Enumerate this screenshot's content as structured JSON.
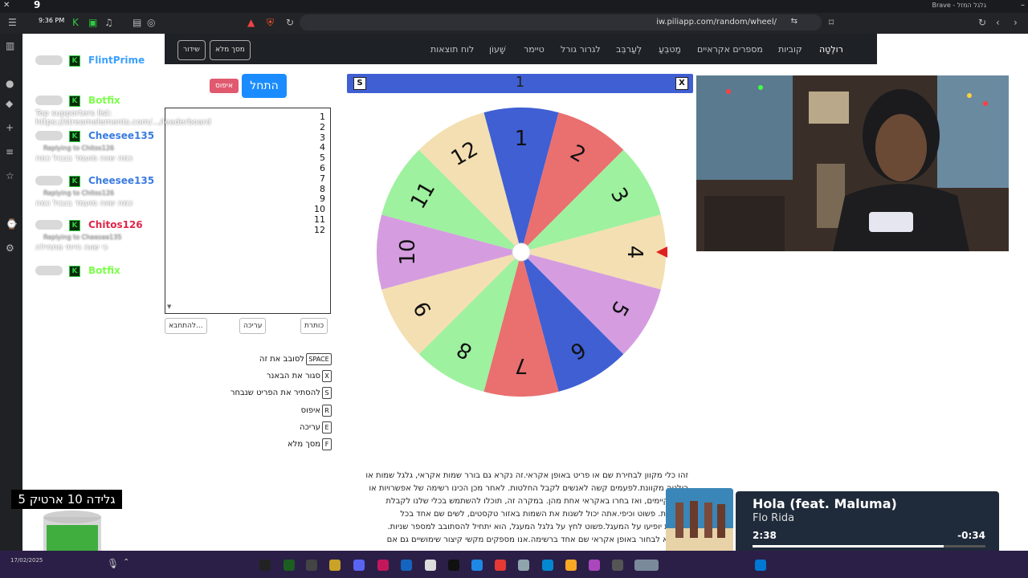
{
  "system": {
    "counter": "9",
    "browser_label": "Brave - גלגל המזל",
    "clock": "9:36 PM"
  },
  "browser": {
    "url": "iw.piliapp.com/random/wheel/"
  },
  "nav": {
    "items": [
      "רולֶטָה",
      "קוביות",
      "מספרים אקראיים",
      "מַטבֵּעַ",
      "לגרור גורל",
      "לְעַרבֵּב",
      "טיימר",
      "שָׁעוֹן",
      "לוח תוצאות"
    ],
    "fullscreen": "מסך מלא",
    "share": "שידור"
  },
  "controls": {
    "start": "התחל",
    "reset": "איפוס",
    "list": [
      "1",
      "2",
      "3",
      "4",
      "5",
      "6",
      "7",
      "8",
      "9",
      "10",
      "11",
      "12"
    ],
    "btn_title": "כותרת",
    "btn_edit": "עריכה",
    "btn_begin": "להתחבא..."
  },
  "shortcuts": [
    {
      "key": "SPACE",
      "label": "לסובב את זה"
    },
    {
      "key": "X",
      "label": "סגור את הבאנר"
    },
    {
      "key": "S",
      "label": "להסתיר את הפריט שנבחר"
    },
    {
      "key": "R",
      "label": "איפוס"
    },
    {
      "key": "E",
      "label": "עריכה"
    },
    {
      "key": "F",
      "label": "מסך מלא"
    }
  ],
  "wheel": {
    "header_value": "1",
    "hide_key": "S",
    "close_key": "X",
    "labels": [
      "1",
      "2",
      "3",
      "4",
      "5",
      "6",
      "7",
      "8",
      "9",
      "10",
      "11",
      "12"
    ],
    "colors": [
      "#3f5fd3",
      "#ea6f6f",
      "#9ef19e",
      "#f4dfb2",
      "#d59de0",
      "#3f5fd3",
      "#ea6f6f",
      "#9ef19e",
      "#f4dfb2",
      "#d59de0",
      "#9ef19e",
      "#f4dfb2"
    ],
    "pointer_color": "#e02020"
  },
  "description": [
    "זהו כלי מקוון לבחירת שם או פריט באופן אקראי.זה נקרא גם בורר שמות אקראי, גלגל שמות או",
    "רולטה מקוונת.לפעמים קשה לאנשים לקבל החלטות. לאחר מכן הכינו רשימה של אפשרויות או",
    "מדים קיימים, ואז בחרו באקראי אחת מהן. במקרה זה, תוכלו להשתמש בכלי שלנו לקבלת",
    "החלטות. פשוט וכיפי.אתה יכול לשנות את השמות באזור טקסטים, לשים שם אחד בכל",
    "השמות יופיעו על המעגל.פשוט לחץ על גלגל המעגל, הוא יתחיל להסתובב למספר שניות.",
    "אה היא לבחור באופן אקראי שם אחד ברשימה.אנו מספקים מקשי קיצור שימושיים גם אם"
  ],
  "chat": [
    {
      "name": "FlintPrime",
      "color": "#3aa0ff",
      "sub": "",
      "msg": ""
    },
    {
      "name": "Botfix",
      "color": "#7cff4a",
      "sub": "",
      "msg": "Top supporters list: https://streamelements.com/.../leaderboard"
    },
    {
      "name": "Cheesee135",
      "color": "#3a7be0",
      "sub": "Replying to Chitos126",
      "msg": "כמה שווה מועמד בגבול כמה"
    },
    {
      "name": "Cheesee135",
      "color": "#3a7be0",
      "sub": "Replying to Chitos126",
      "msg": "כמה שווה מועמד בגבול כמה"
    },
    {
      "name": "Chitos126",
      "color": "#e0264a",
      "sub": "Replying to Cheesee135",
      "msg": "כי שווה הייתי מתחילה"
    },
    {
      "name": "Botfix",
      "color": "#7cff4a",
      "sub": "",
      "msg": ""
    }
  ],
  "goal": {
    "text": "גלידה 10 ארטיק 5"
  },
  "music": {
    "title": "Hola (feat. Maluma)",
    "artist": "Flo Rida",
    "elapsed": "2:38",
    "remaining": "-0:34",
    "progress": 0.82
  },
  "taskbar": {
    "date": "17/02/2025"
  }
}
